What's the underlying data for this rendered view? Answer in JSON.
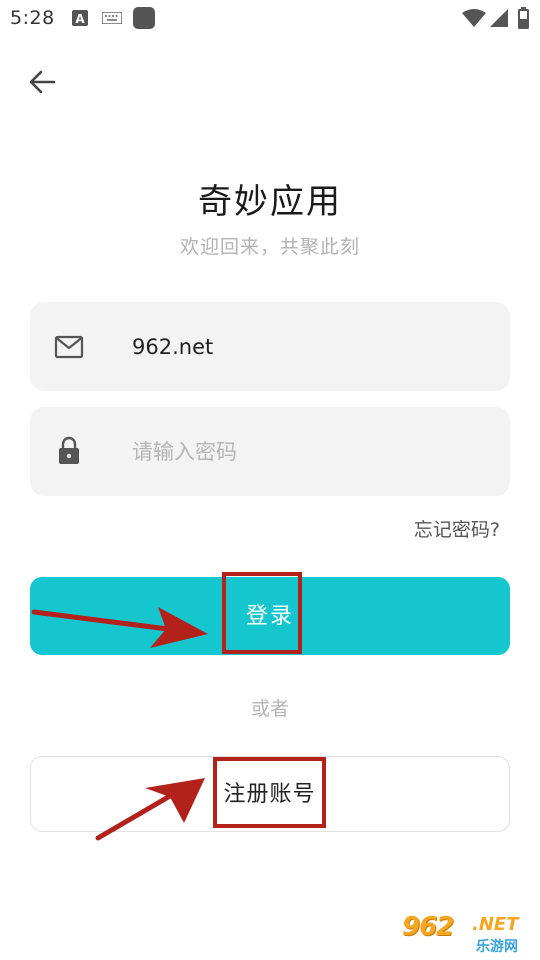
{
  "status_bar": {
    "time": "5:28",
    "icons": [
      "a-keyboard-notification-icon",
      "keyboard-icon",
      "app-notification-icon",
      "wifi-icon",
      "signal-icon",
      "battery-icon"
    ]
  },
  "header": {
    "back_icon": "arrow-left-icon"
  },
  "app": {
    "title": "奇妙应用",
    "subtitle": "欢迎回来，共聚此刻"
  },
  "form": {
    "email": {
      "icon": "mail-icon",
      "value": "962.net",
      "placeholder": ""
    },
    "password": {
      "icon": "lock-icon",
      "value": "",
      "placeholder": "请输入密码"
    },
    "forgot_label": "忘记密码?"
  },
  "actions": {
    "login_label": "登录",
    "or_label": "或者",
    "register_label": "注册账号"
  },
  "colors": {
    "accent": "#16c6ce",
    "annotation": "#b3211b"
  },
  "watermark": {
    "main": "962",
    "suffix": ".NET",
    "sub": "乐游网"
  }
}
